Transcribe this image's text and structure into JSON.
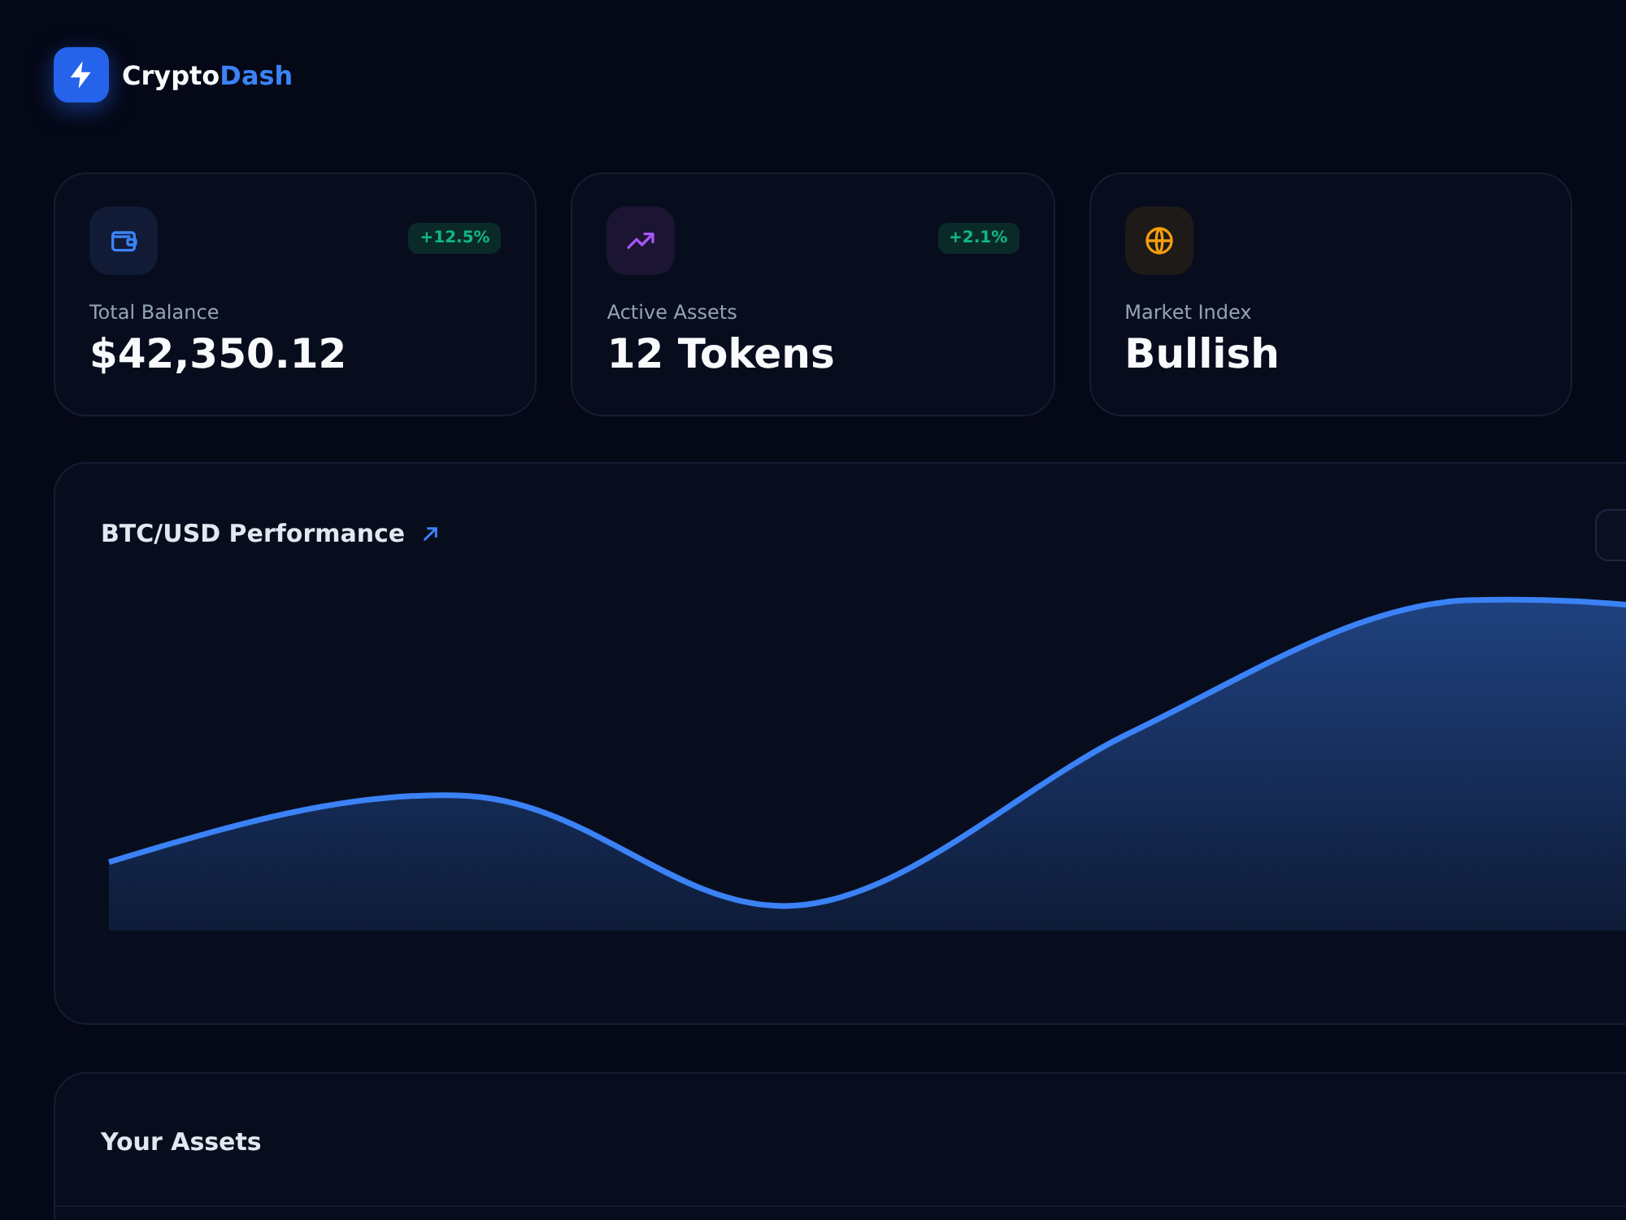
{
  "brand": {
    "name": "Crypto",
    "accent": "Dash"
  },
  "stats": [
    {
      "kind": "wallet",
      "label": "Total Balance",
      "value": "$42,350.12",
      "badge": "+12.5%"
    },
    {
      "kind": "trend",
      "label": "Active Assets",
      "value": "12 Tokens",
      "badge": "+2.1%"
    },
    {
      "kind": "globe",
      "label": "Market Index",
      "value": "Bullish"
    }
  ],
  "chart_panel": {
    "title": "BTC/USD Performance"
  },
  "assets_panel": {
    "title": "Your Assets"
  }
}
